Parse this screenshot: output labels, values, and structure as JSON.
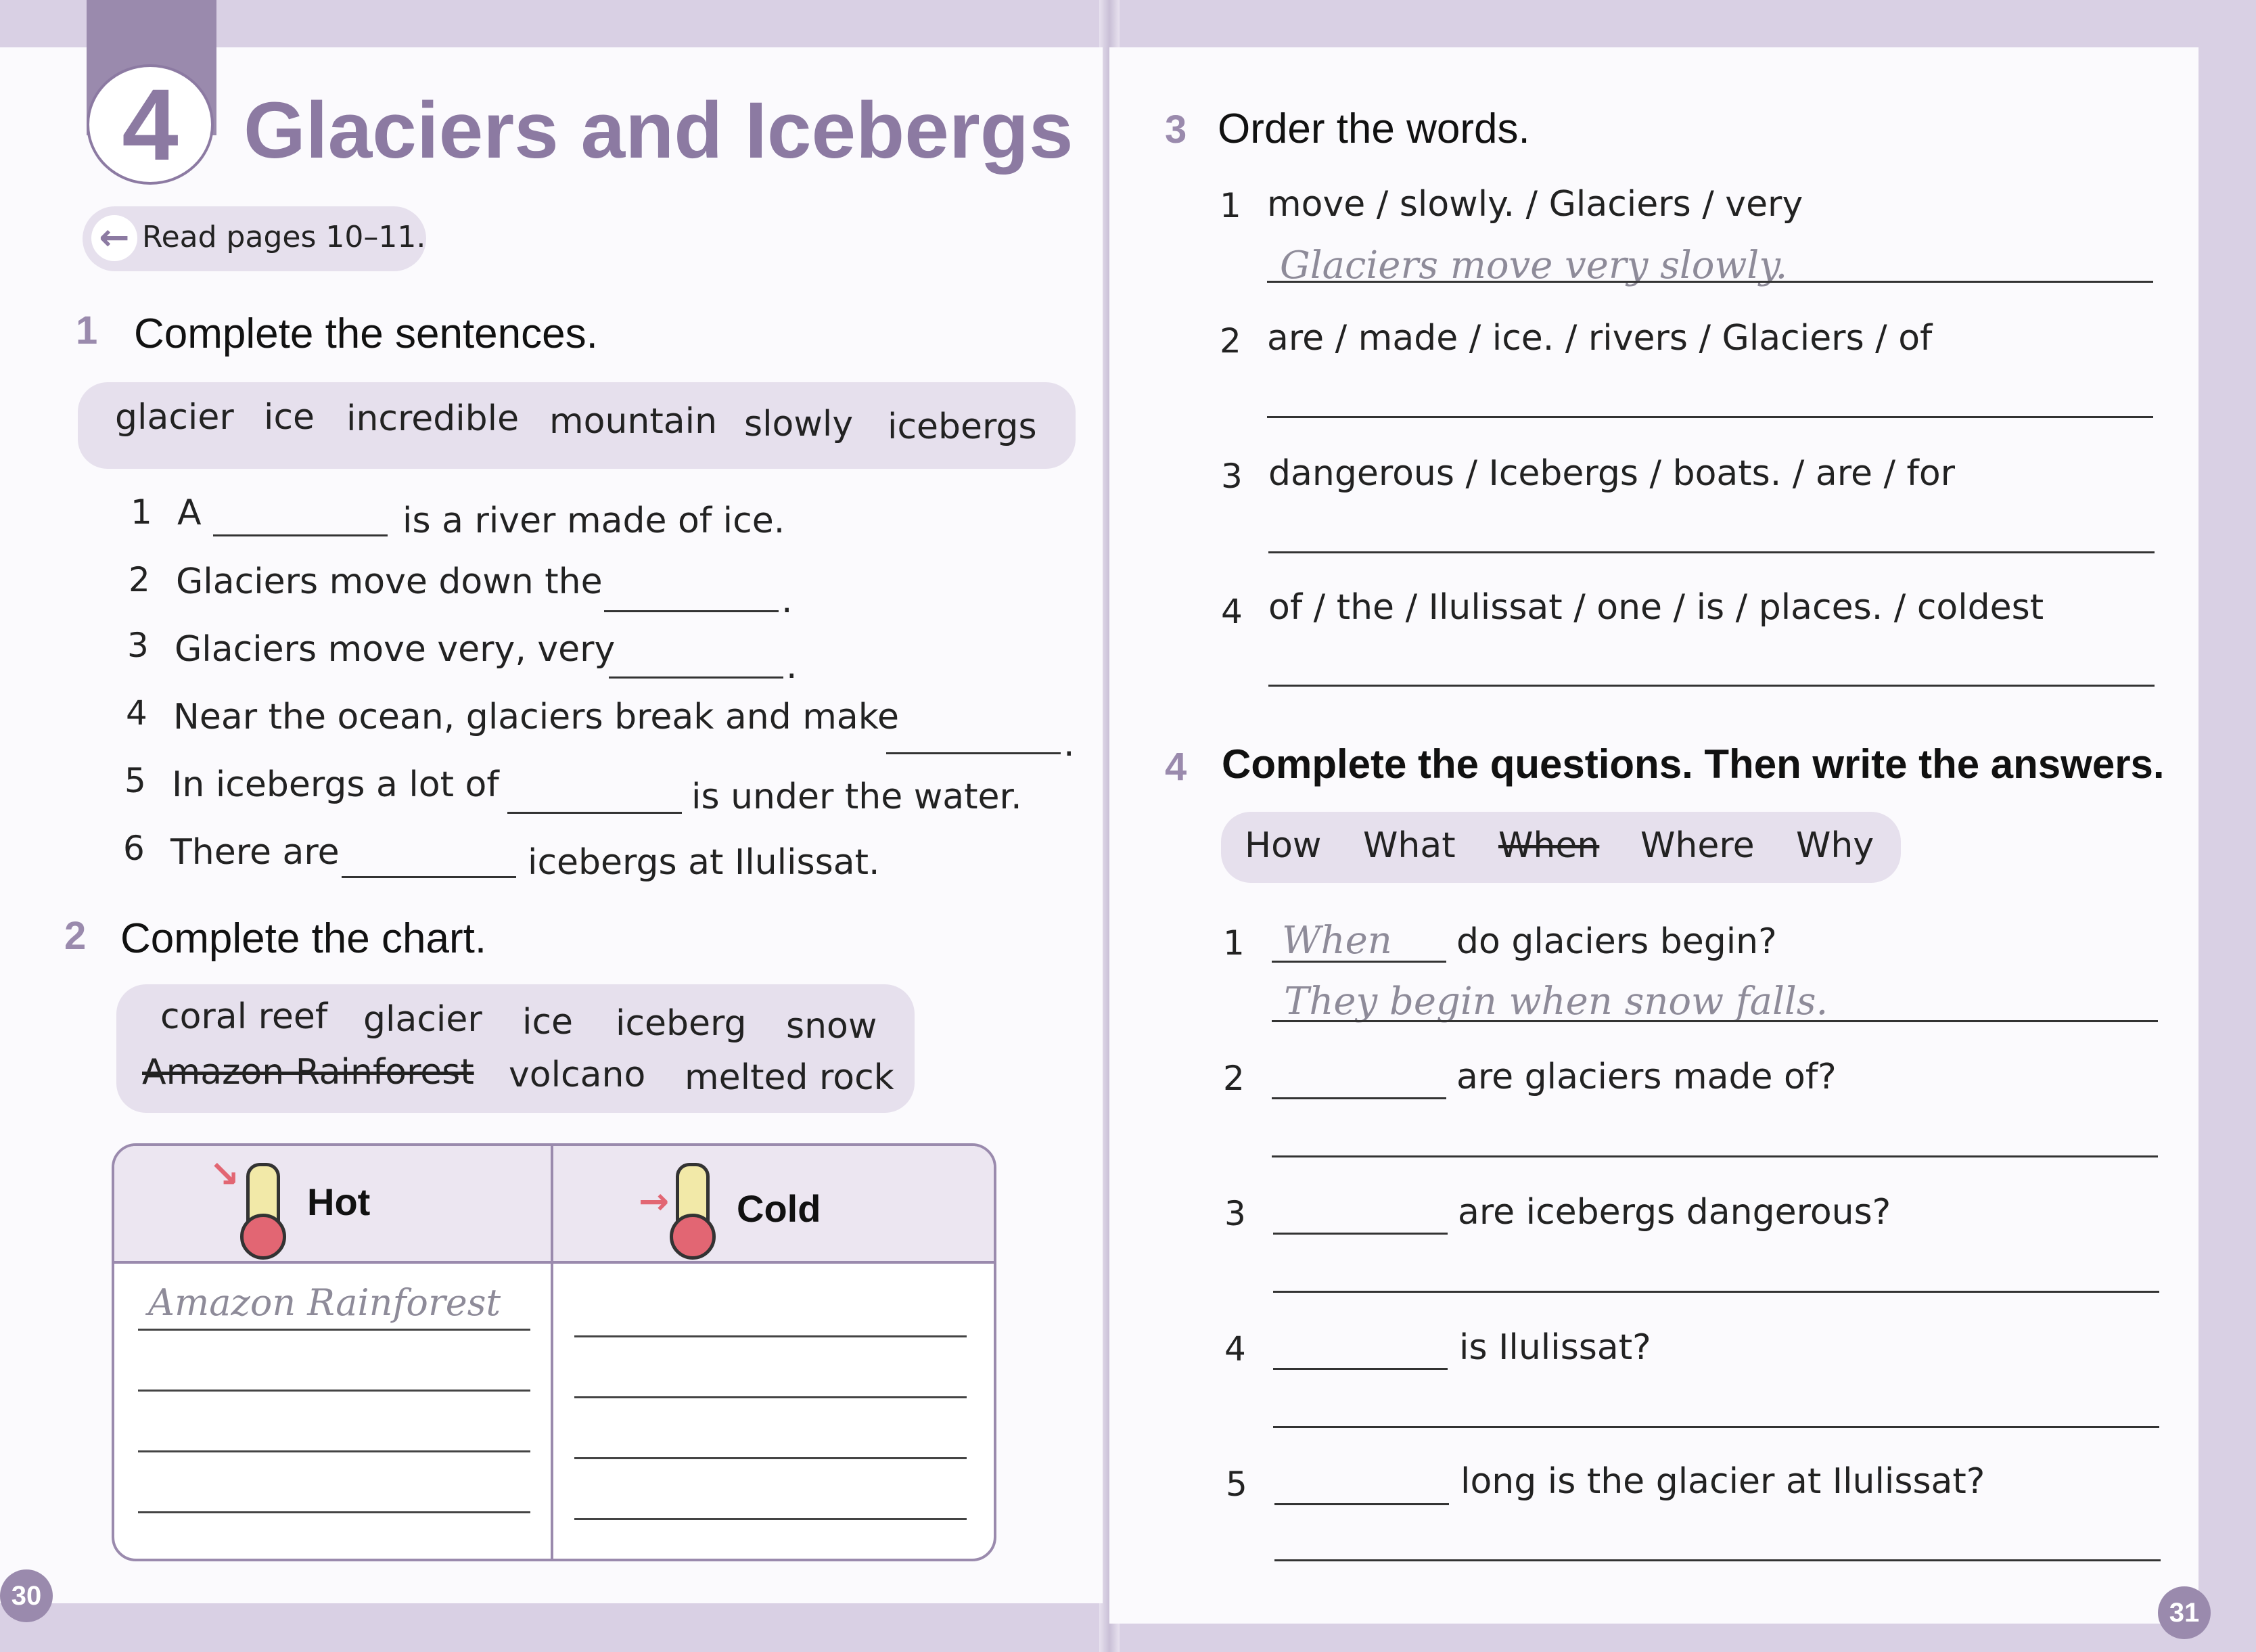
{
  "left_page": {
    "unit_number": "4",
    "title": "Glaciers and Icebergs",
    "read_note": "Read pages 10–11.",
    "page_number": "30",
    "ex1": {
      "number": "1",
      "instruction": "Complete the sentences.",
      "word_bank": [
        "glacier",
        "ice",
        "incredible",
        "mountain",
        "slowly",
        "icebergs"
      ],
      "items": [
        {
          "n": "1",
          "before": "A",
          "after": "is a river made of ice."
        },
        {
          "n": "2",
          "before": "Glaciers move down the",
          "after": "."
        },
        {
          "n": "3",
          "before": "Glaciers move very, very",
          "after": "."
        },
        {
          "n": "4",
          "before": "Near the ocean, glaciers break and make",
          "after": "."
        },
        {
          "n": "5",
          "before": "In icebergs a lot of",
          "after": "is under the water."
        },
        {
          "n": "6",
          "before": "There are",
          "after": "icebergs at Ilulissat."
        }
      ]
    },
    "ex2": {
      "number": "2",
      "instruction": "Complete the chart.",
      "word_bank_row1": [
        "coral reef",
        "glacier",
        "ice",
        "iceberg",
        "snow"
      ],
      "word_bank_row2": [
        "Amazon Rainforest",
        "volcano",
        "melted rock"
      ],
      "chart": {
        "hot_label": "Hot",
        "cold_label": "Cold",
        "hot_example": "Amazon Rainforest"
      }
    }
  },
  "right_page": {
    "page_number": "31",
    "ex3": {
      "number": "3",
      "instruction": "Order the words.",
      "items": [
        {
          "n": "1",
          "words": "move / slowly. / Glaciers / very",
          "answer": "Glaciers move very slowly."
        },
        {
          "n": "2",
          "words": "are / made / ice. / rivers / Glaciers / of",
          "answer": ""
        },
        {
          "n": "3",
          "words": "dangerous / Icebergs / boats. / are / for",
          "answer": ""
        },
        {
          "n": "4",
          "words": "of / the / Ilulissat / one / is / places. / coldest",
          "answer": ""
        }
      ]
    },
    "ex4": {
      "number": "4",
      "instruction": "Complete the questions. Then write the answers.",
      "word_bank": [
        "How",
        "What",
        "When",
        "Where",
        "Why"
      ],
      "items": [
        {
          "n": "1",
          "fill": "When",
          "question": "do glaciers begin?",
          "answer": "They begin when snow falls."
        },
        {
          "n": "2",
          "fill": "",
          "question": "are glaciers made of?",
          "answer": ""
        },
        {
          "n": "3",
          "fill": "",
          "question": "are icebergs dangerous?",
          "answer": ""
        },
        {
          "n": "4",
          "fill": "",
          "question": "is Ilulissat?",
          "answer": ""
        },
        {
          "n": "5",
          "fill": "",
          "question": "long is the glacier at Ilulissat?",
          "answer": ""
        }
      ]
    }
  }
}
